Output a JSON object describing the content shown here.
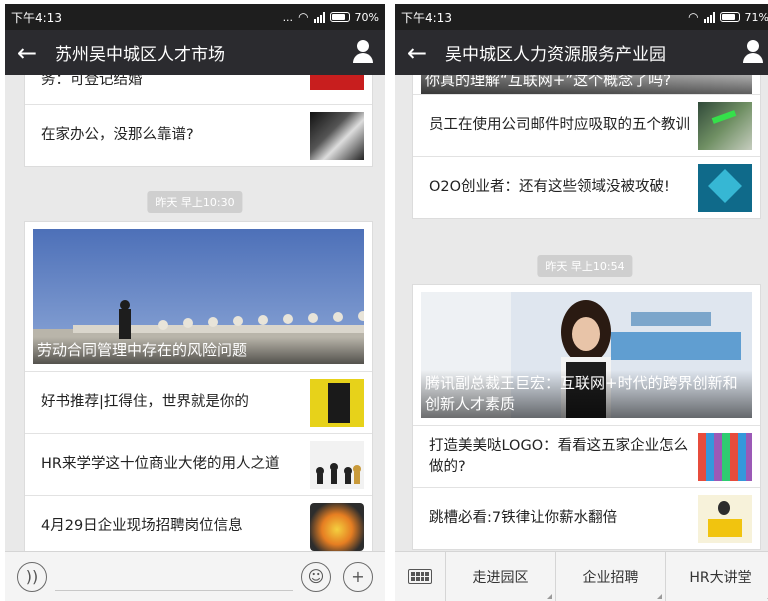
{
  "left": {
    "status": {
      "time": "下午4:13",
      "dots": "...",
      "battery": "70%"
    },
    "title": "苏州吴中城区人才市场",
    "top_partial": "务：可登记结婚",
    "card1": [
      {
        "title": "在家办公，没那么靠谱?"
      }
    ],
    "timestamp": "昨天 早上10:30",
    "cover_title": "劳动合同管理中存在的风险问题",
    "card2": [
      {
        "title": "好书推荐|扛得住，世界就是你的"
      },
      {
        "title": "HR来学学这十位商业大佬的用人之道"
      },
      {
        "title": "4月29日企业现场招聘岗位信息"
      }
    ]
  },
  "right": {
    "status": {
      "time": "下午4:13",
      "battery": "71%"
    },
    "title": "吴中城区人力资源服务产业园",
    "top_partial": "你真的理解“互联网+”这个概念了吗?",
    "card1": [
      {
        "title": "员工在使用公司邮件时应吸取的五个教训"
      },
      {
        "title": "O2O创业者：还有这些领域没被攻破!"
      }
    ],
    "timestamp": "昨天 早上10:54",
    "cover_title": "腾讯副总裁王巨宏：互联网+时代的跨界创新和创新人才素质",
    "card2": [
      {
        "title": "打造美美哒LOGO：看看这五家企业怎么做的?"
      },
      {
        "title": "跳槽必看:7铁律让你薪水翻倍"
      }
    ],
    "menu": [
      "走进园区",
      "企业招聘",
      "HR大讲堂"
    ]
  },
  "colors": {
    "title_bar": "#2b2b2f",
    "status_bar": "#1e1e1e",
    "feed_bg": "#e9e9e9"
  }
}
